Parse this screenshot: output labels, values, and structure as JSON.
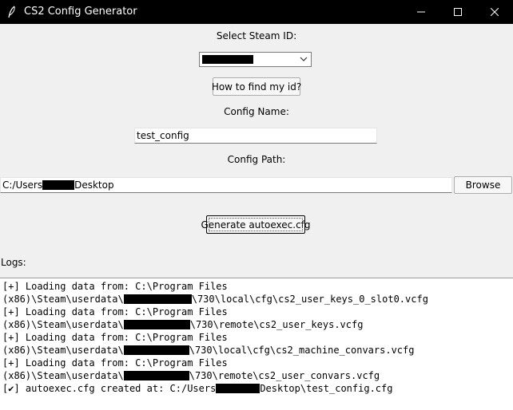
{
  "window": {
    "title": "CS2 Config Generator",
    "icon": "feather-icon",
    "controls": [
      "minimize-icon",
      "maximize-icon",
      "close-icon"
    ]
  },
  "steam": {
    "label": "Select Steam ID:",
    "help_button": "How to find my id?"
  },
  "config_name": {
    "label": "Config Name:",
    "value": "test_config"
  },
  "config_path": {
    "label": "Config Path:",
    "value_prefix": "C:/Users",
    "value_suffix": "Desktop",
    "browse_button": "Browse"
  },
  "generate_button": "Generate autoexec.cfg",
  "logs": {
    "label": "Logs:",
    "lines": [
      {
        "a": "[+] Loading data from: C:\\Program Files",
        "b": ""
      },
      {
        "a": "(x86)\\Steam\\userdata\\",
        "b": "\\730\\local\\cfg\\cs2_user_keys_0_slot0.vcfg"
      },
      {
        "a": "[+] Loading data from: C:\\Program Files",
        "b": ""
      },
      {
        "a": "(x86)\\Steam\\userdata\\",
        "b": "\\730\\remote\\cs2_user_keys.vcfg"
      },
      {
        "a": "[+] Loading data from: C:\\Program Files",
        "b": ""
      },
      {
        "a": "(x86)\\Steam\\userdata\\",
        "b": "\\730\\local\\cfg\\cs2_machine_convars.vcfg"
      },
      {
        "a": "[+] Loading data from: C:\\Program Files",
        "b": ""
      },
      {
        "a": "(x86)\\Steam\\userdata\\",
        "b": "\\730\\remote\\cs2_user_convars.vcfg"
      },
      {
        "a": "[✔] autoexec.cfg created at: C:/Users",
        "b": "Desktop\\test_config.cfg"
      }
    ]
  }
}
